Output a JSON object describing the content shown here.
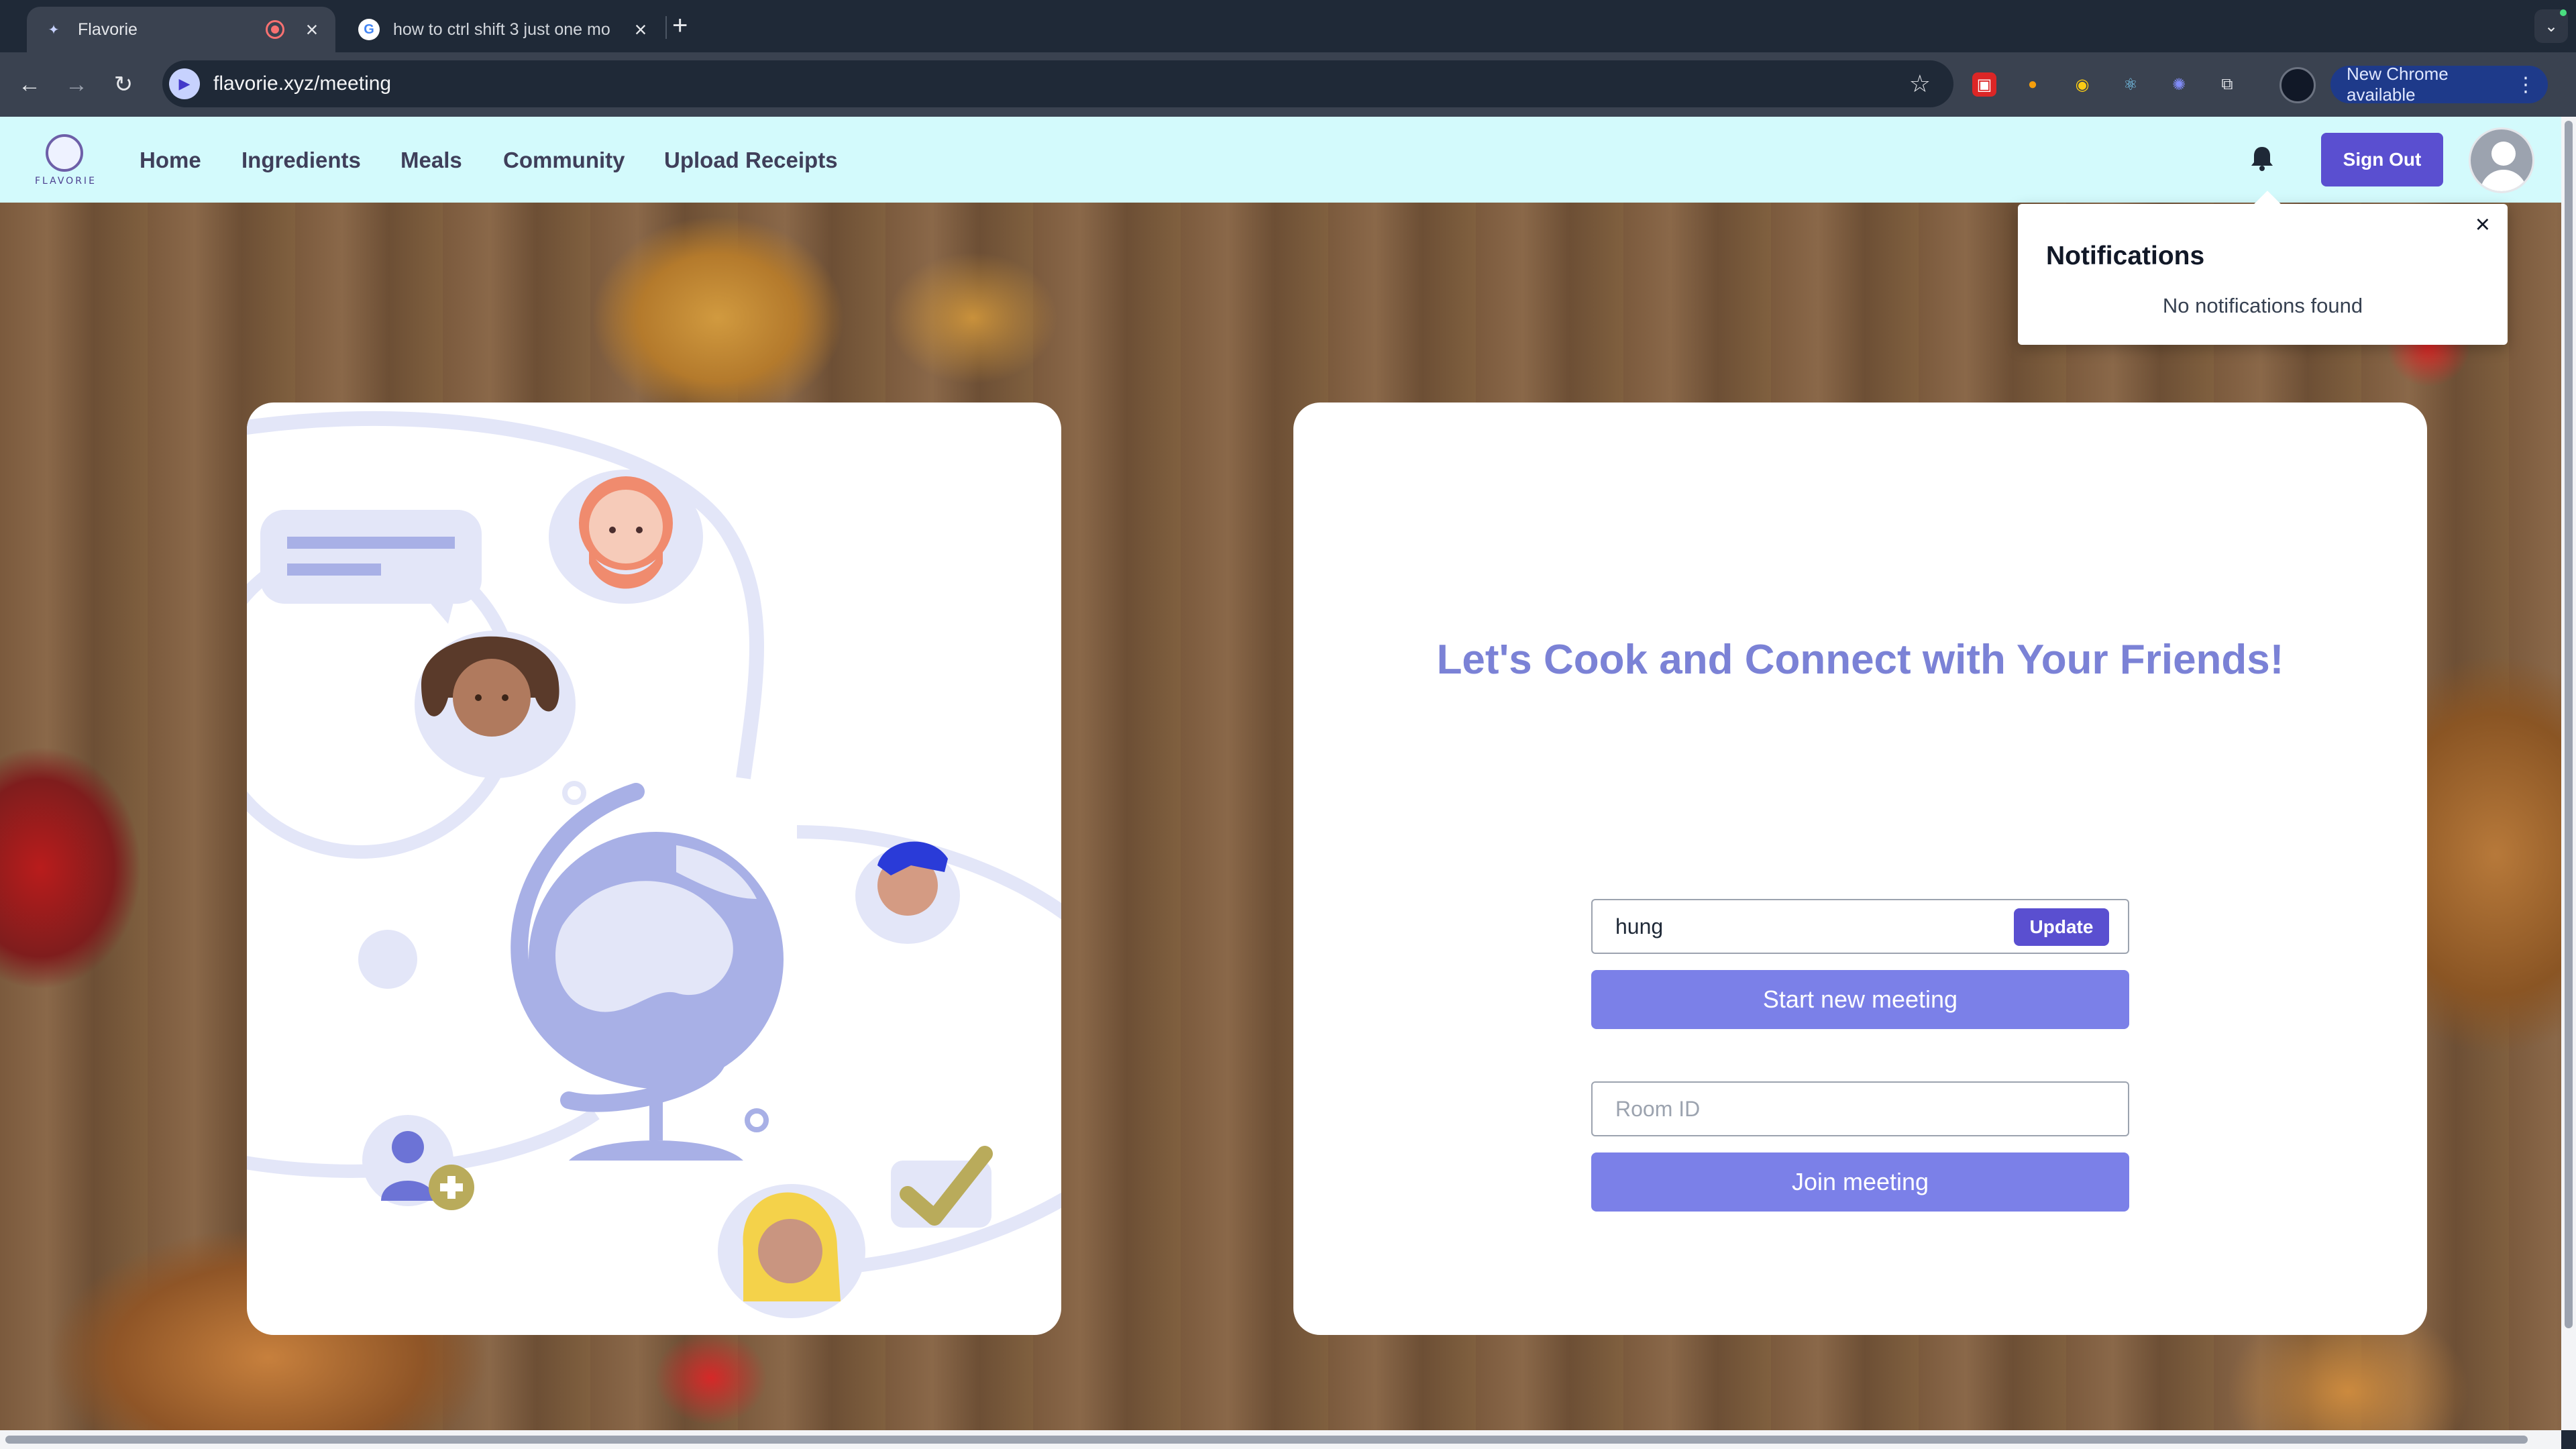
{
  "browser": {
    "tabs": [
      {
        "title": "Flavorie",
        "active": true
      },
      {
        "title": "how to ctrl shift 3 just one mo",
        "active": false
      }
    ],
    "url": "flavorie.xyz/meeting",
    "update_chip": "New Chrome available"
  },
  "header": {
    "logo_text": "FLAVORIE",
    "nav": [
      "Home",
      "Ingredients",
      "Meals",
      "Community",
      "Upload Receipts"
    ],
    "sign_out": "Sign Out"
  },
  "notifications": {
    "title": "Notifications",
    "empty_text": "No notifications found"
  },
  "meeting": {
    "headline": "Let's Cook and Connect with Your Friends!",
    "name_value": "hung",
    "update_label": "Update",
    "start_label": "Start new meeting",
    "room_placeholder": "Room ID",
    "join_label": "Join meeting"
  },
  "colors": {
    "brand": "#5a4fd0",
    "button": "#7b80e8",
    "appbar": "#d3fafc",
    "headline": "#7b82d6"
  }
}
